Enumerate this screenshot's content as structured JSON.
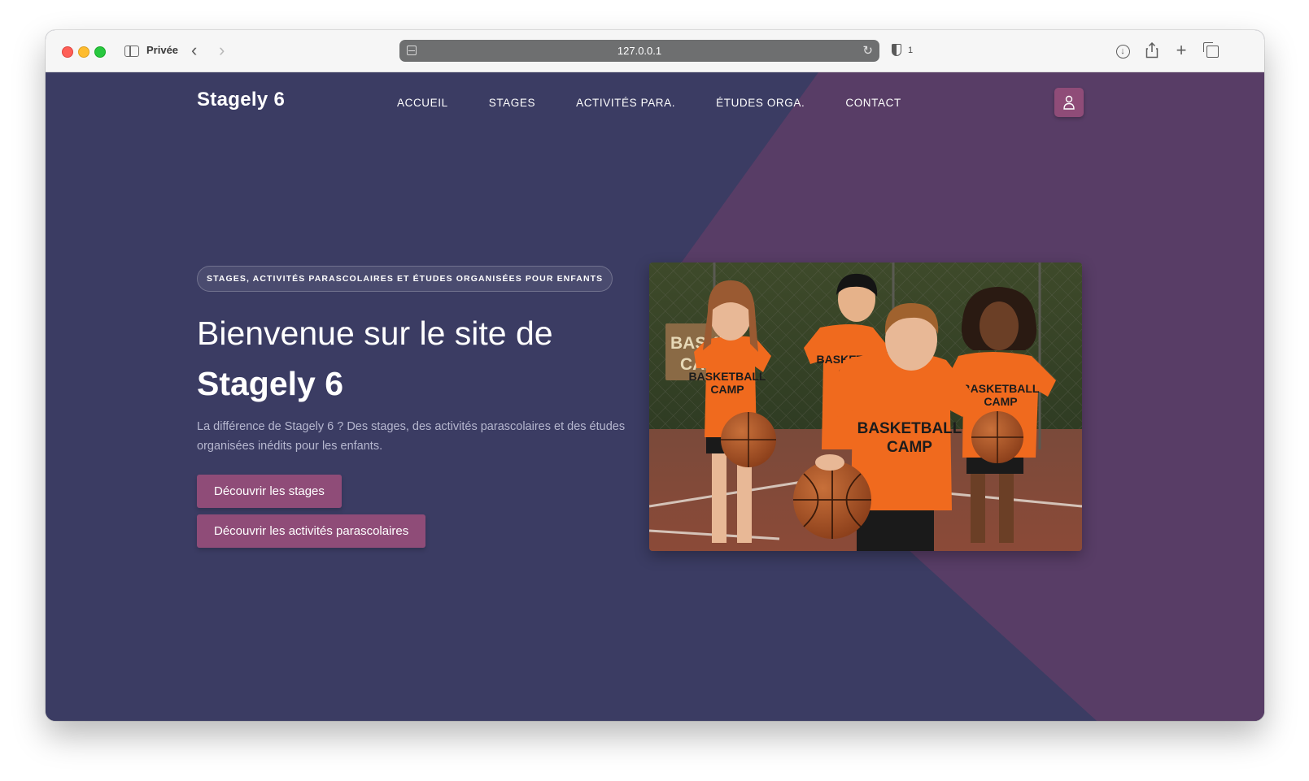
{
  "browser": {
    "private_label": "Privée",
    "url": "127.0.0.1",
    "blocked_count": "1",
    "icons": {
      "back": "chevron-left-icon",
      "forward": "chevron-right-icon",
      "download": "download-icon",
      "share": "share-icon",
      "new_tab": "plus-icon",
      "tabs": "tab-overview-icon"
    }
  },
  "site": {
    "logo": "Stagely 6",
    "nav": [
      "ACCUEIL",
      "STAGES",
      "ACTIVITÉS PARA.",
      "ÉTUDES ORGA.",
      "CONTACT"
    ],
    "account_icon": "user-icon"
  },
  "hero": {
    "tagline": "STAGES, ACTIVITÉS PARASCOLAIRES ET ÉTUDES ORGANISÉES POUR ENFANTS",
    "title_line1": "Bienvenue sur le site de",
    "title_line2": "Stagely 6",
    "description": "La différence de Stagely 6 ? Des stages, des activités parascolaires et des études organisées inédits pour les enfants.",
    "buttons": [
      "Découvrir les stages",
      "Découvrir les activités parascolaires"
    ],
    "image": {
      "sign_text": "BASKET CAM",
      "shirt_line1": "BASKETBALL",
      "shirt_line2": "CAMP"
    }
  },
  "colors": {
    "page_bg": "#3b3c63",
    "accent_bg": "#583d66",
    "button": "#8f4c78",
    "shirt": "#f06a1e"
  }
}
